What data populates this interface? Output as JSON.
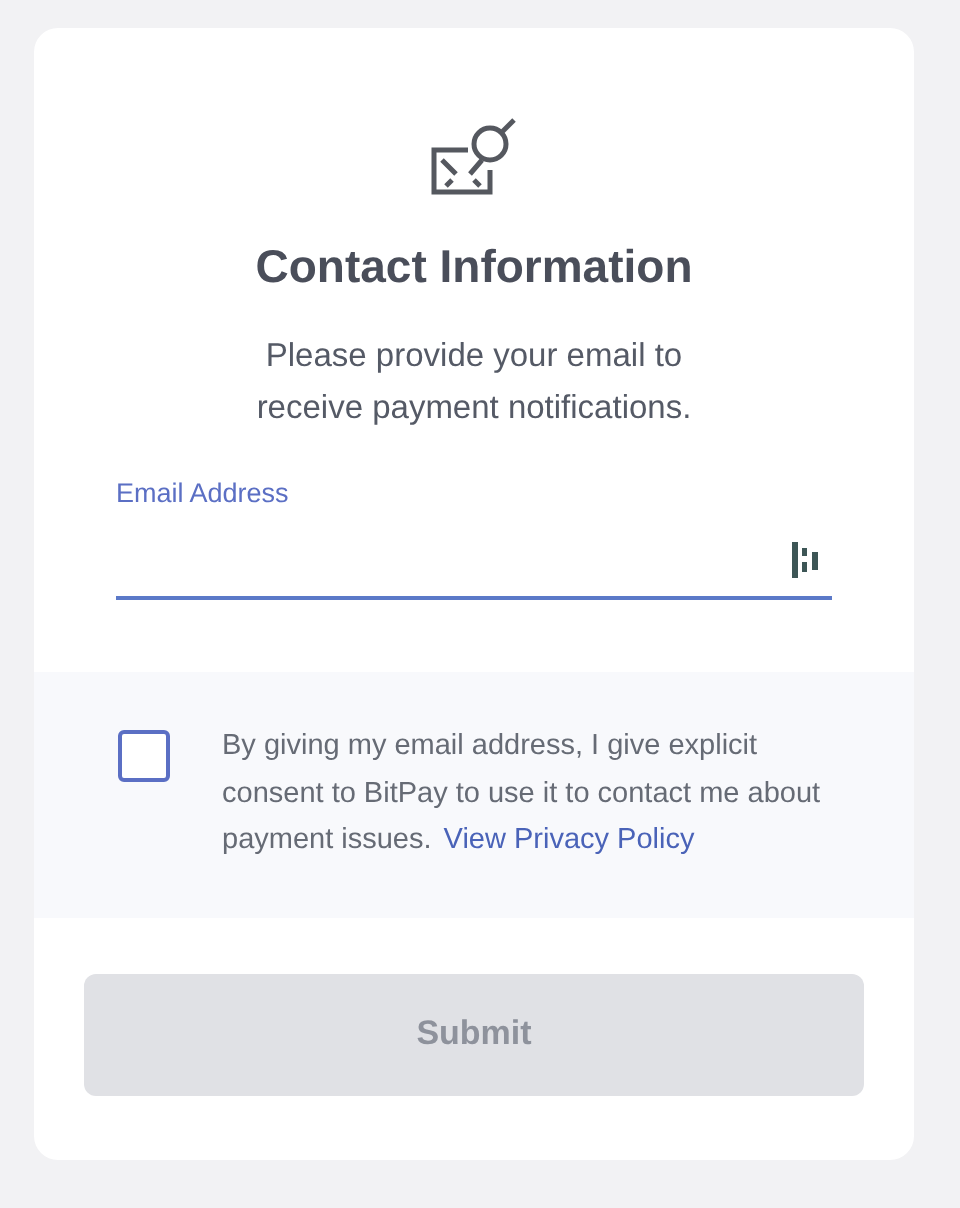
{
  "title": "Contact Information",
  "subtitle": "Please provide your email to receive payment notifications.",
  "email_field": {
    "label": "Email Address"
  },
  "consent": {
    "checked": false,
    "text": "By giving my email address, I give explicit consent to BitPay to use it to contact me about payment issues.",
    "link": "View Privacy Policy"
  },
  "submit": {
    "label": "Submit",
    "disabled": true
  }
}
